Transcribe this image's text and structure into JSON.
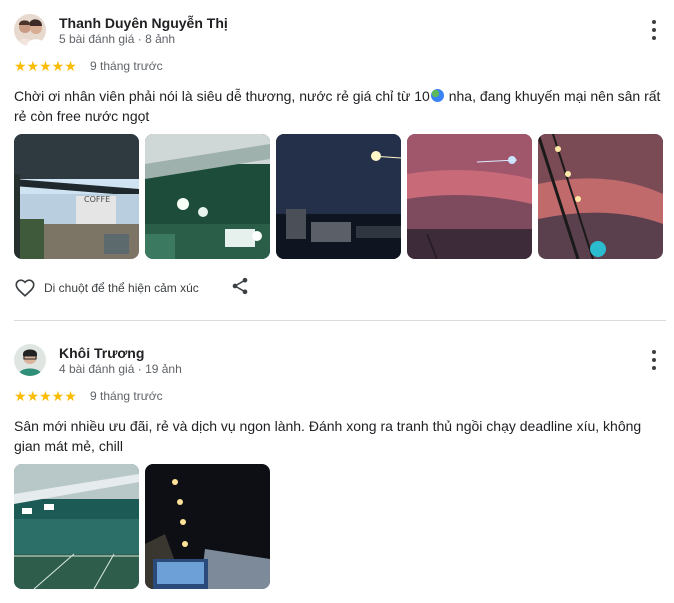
{
  "reviews": [
    {
      "author": "Thanh Duyên Nguyễn Thị",
      "meta": "5 bài đánh giá · 8 ảnh",
      "stars": "★★★★★",
      "rating": 5,
      "time": "9 tháng trước",
      "text_before_icon": "Chời ơi nhân viên phải nói là siêu dễ thương, nước rẻ giá chỉ từ 10",
      "text_after_icon": " nha, đang khuyến mại nên sân rất rẻ còn free nước ngọt",
      "photo_count": 5
    },
    {
      "author": "Khôi Trương",
      "meta": "4 bài đánh giá · 19 ảnh",
      "stars": "★★★★★",
      "rating": 5,
      "time": "9 tháng trước",
      "text": "Sân mới nhiều ưu đãi, rẻ và dịch vụ ngon lành. Đánh xong ra tranh thủ ngồi chạy deadline xíu, không gian mát mẻ, chill",
      "photo_count": 2
    }
  ],
  "reaction_label": "Di chuột để thể hiện cảm xúc",
  "icons": {
    "more": "more-vert-icon",
    "heart": "heart-outline-icon",
    "share": "share-icon",
    "globe": "globe-emoji-icon"
  },
  "colors": {
    "star": "#fbbc04",
    "secondary_text": "#5f6368",
    "divider": "#dadce0"
  }
}
